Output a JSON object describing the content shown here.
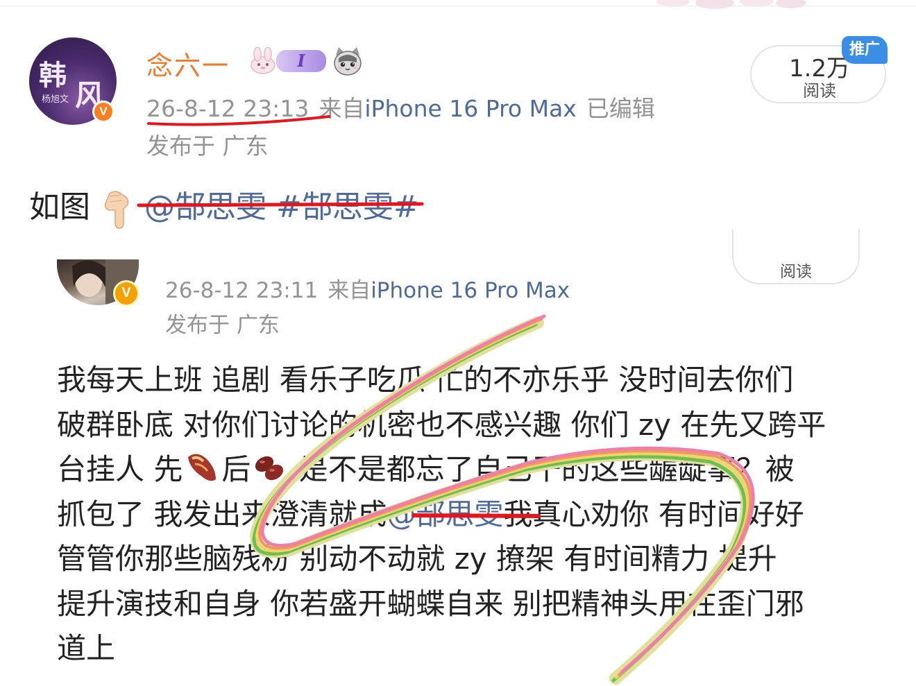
{
  "post": {
    "author": {
      "name": "念六一",
      "avatar_text_1": "韩",
      "avatar_text_2": "风",
      "avatar_text_3": "杨旭文",
      "verified_mark": "V",
      "level_badge": "I"
    },
    "time": "26-8-12 23:13",
    "source_prefix": "来自",
    "device": "iPhone 16 Pro Max",
    "edited": "已编辑",
    "location": "发布于 广东",
    "read_count": "1.2万",
    "read_label": "阅读",
    "promo_label": "推广",
    "text_prefix": "如图",
    "mention": "@郜思雯",
    "topic": "#郜思雯#"
  },
  "original": {
    "verified_mark": "V",
    "time": "26-8-12 23:11",
    "source_prefix": "来自",
    "device": "iPhone 16 Pro Max",
    "location": "发布于 广东",
    "read_label": "阅读",
    "body": {
      "line1": "我每天上班 追剧 看乐子吃瓜 忙的不亦乐乎 没时间去你们",
      "line2": "破群卧底 对你们讨论的机密也不感兴趣 你们 zy 在先又跨平",
      "line3_a": "台挂人 先",
      "line3_b": "后",
      "line3_c": " 是不是都忘了自己干的这些龌龊事？被",
      "line4_a": "抓包了 我发出来澄清就成",
      "line4_mention": "@郜思雯",
      "line4_b": "我真心劝你 有时间好好",
      "line5": "管管你那些脑残粉 别动不动就 zy 撩架 有时间精力 提升",
      "line6": "提升演技和自身 你若盛开蝴蝶自来 别把精神头用在歪门邪",
      "line7": "道上"
    }
  },
  "icons": {
    "hand": "backhand-index-pointing-down",
    "sweet_potato": "roasted-sweet-potato",
    "beans": "beans",
    "rabbit": "rabbit-badge",
    "cat": "cat-badge"
  },
  "colors": {
    "username": "#f07a2b",
    "link": "#4d6a9a",
    "meta": "#939393",
    "annotation_red": "#e8141c",
    "promo": "#3a8ee6",
    "verified": "#f7801f"
  }
}
